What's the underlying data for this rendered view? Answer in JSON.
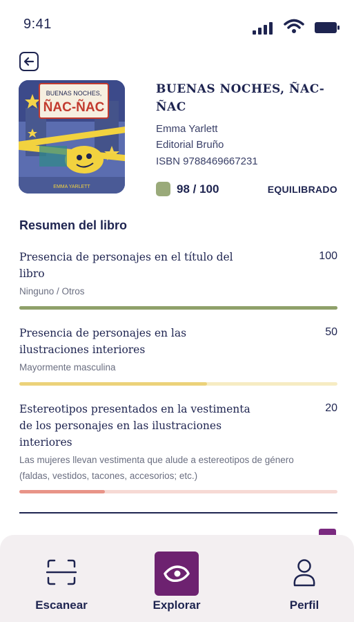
{
  "status_bar": {
    "time": "9:41"
  },
  "book": {
    "title": "BUENAS NOCHES, ÑAC-ÑAC",
    "author": "Emma Yarlett",
    "publisher": "Editorial Bruño",
    "isbn": "ISBN 9788469667231",
    "score": "98 / 100",
    "verdict": "EQUILIBRADO",
    "score_color": "#9aaa7a",
    "cover": {
      "top_text": "BUENAS NOCHES,",
      "main_text": "ÑAC-ÑAC",
      "author_text": "EMMA YARLETT"
    }
  },
  "summary": {
    "heading": "Resumen del libro",
    "criteria": [
      {
        "label": "Presencia de personajes en el título del libro",
        "value": "100",
        "fraction": 1.0,
        "sub": "Ninguno / Otros",
        "color": "#8fa06a",
        "track_color": "#8fa06a"
      },
      {
        "label": "Presencia de personajes en las ilustraciones interiores",
        "value": "50",
        "fraction": 0.59,
        "sub": "Mayormente masculina",
        "color": "#ecd27a",
        "track_color": "#f6ecc3"
      },
      {
        "label": "Estereotipos presentados en la vestimenta de los personajes en las ilustraciones interiores",
        "value": "20",
        "fraction": 0.27,
        "sub": "Las mujeres llevan vestimenta que alude a estereotipos de género (faldas, vestidos, tacones, accesorios; etc.)",
        "color": "#e89488",
        "track_color": "#f6d9d4"
      }
    ]
  },
  "nav": {
    "items": [
      {
        "label": "Escanear",
        "icon": "scan-icon"
      },
      {
        "label": "Explorar",
        "icon": "eye-icon"
      },
      {
        "label": "Perfil",
        "icon": "user-icon"
      }
    ],
    "accent": "#6d2270"
  }
}
